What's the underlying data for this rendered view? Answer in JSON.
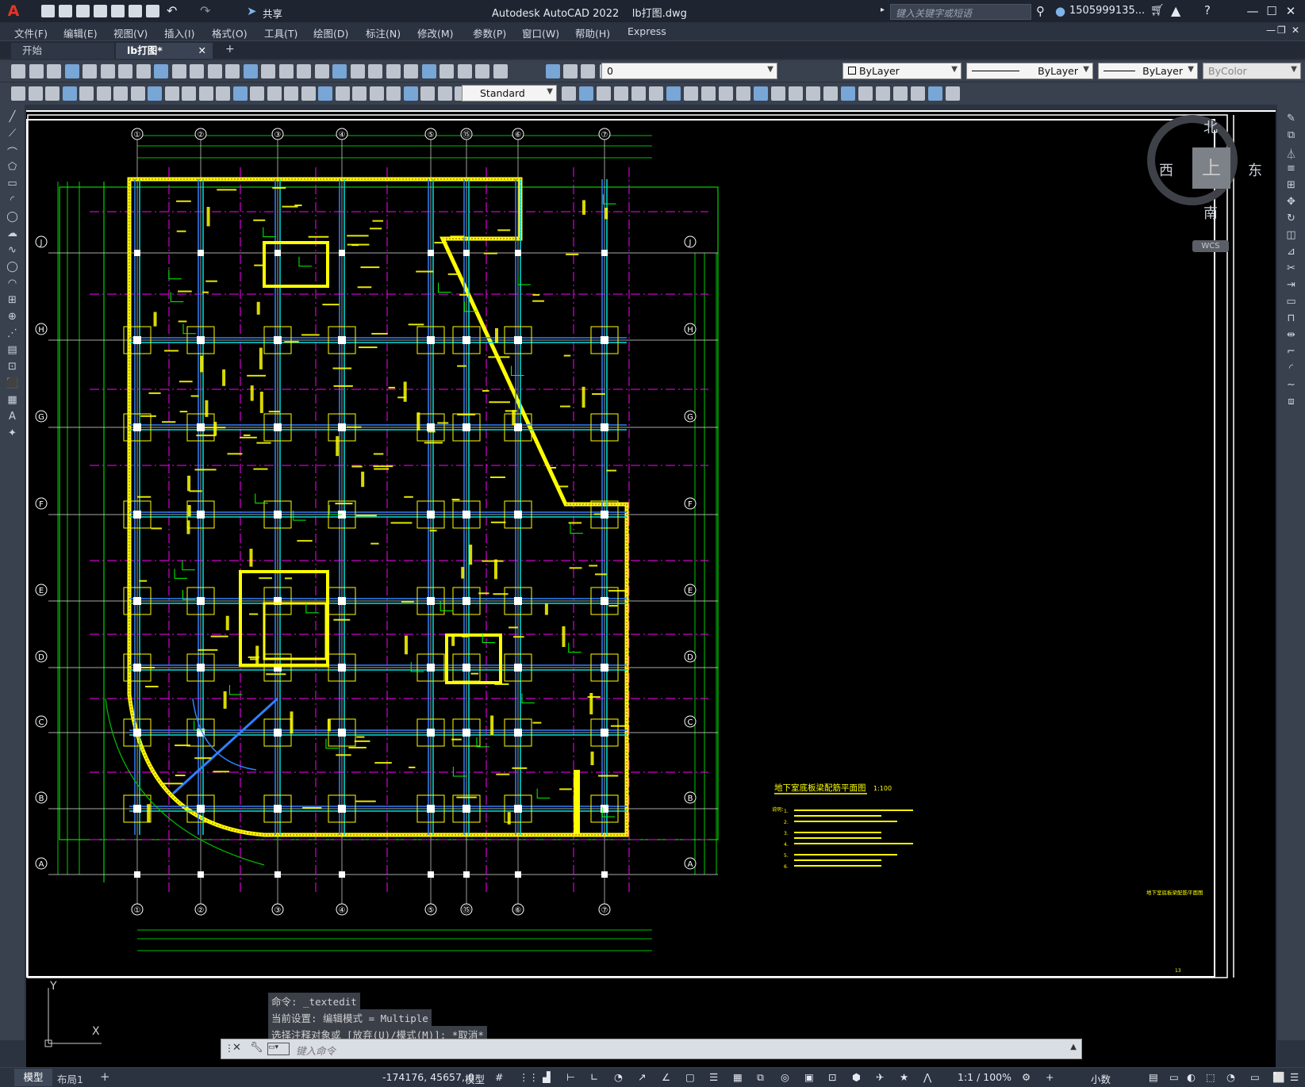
{
  "titlebar": {
    "app_name": "Autodesk AutoCAD 2022",
    "file_name": "lb打图.dwg",
    "share_label": "共享",
    "search_placeholder": "键入关键字或短语",
    "user": "1505999135..."
  },
  "menu": [
    "文件(F)",
    "编辑(E)",
    "视图(V)",
    "插入(I)",
    "格式(O)",
    "工具(T)",
    "绘图(D)",
    "标注(N)",
    "修改(M)",
    "参数(P)",
    "窗口(W)",
    "帮助(H)",
    "Express"
  ],
  "tabs": {
    "start": "开始",
    "doc": "lb打图*",
    "add": "+"
  },
  "layer_combo": "0",
  "color_combo": "ByLayer",
  "linetype_combo": "ByLayer",
  "lineweight_combo": "ByLayer",
  "plotstyle_combo": "ByColor",
  "textstyle_combo": "Standard",
  "viewcube": {
    "north": "北",
    "south": "南",
    "east": "东",
    "west": "西",
    "top": "上",
    "wcs": "WCS"
  },
  "grid": {
    "columns": [
      "①",
      "②",
      "③",
      "④",
      "⑤",
      "⑮",
      "⑥",
      "⑦"
    ],
    "rows": [
      "J",
      "H",
      "G",
      "F",
      "E",
      "D",
      "C",
      "B",
      "A"
    ]
  },
  "drawing": {
    "title": "地下室底板梁配筋平面图",
    "scale": "1:100",
    "notes_label": "说明：",
    "notes": [
      "1.",
      "2.",
      "3.",
      "4.",
      "5.",
      "6."
    ],
    "titleblock": "地下室底板梁配筋平面图",
    "sheet_number": "13"
  },
  "command": {
    "line1": "命令: _textedit",
    "line2": "当前设置: 编辑模式 = Multiple",
    "line3": "选择注释对象或 [放弃(U)/模式(M)]: *取消*",
    "input_placeholder": "键入命令"
  },
  "ucs": {
    "y": "Y",
    "x": "X"
  },
  "layout_tabs": {
    "model": "模型",
    "layout1": "布局1",
    "add": "+"
  },
  "status": {
    "coords": "-174176, 45657, 0",
    "space": "模型",
    "scale": "1:1 / 100%",
    "units": "小数"
  }
}
